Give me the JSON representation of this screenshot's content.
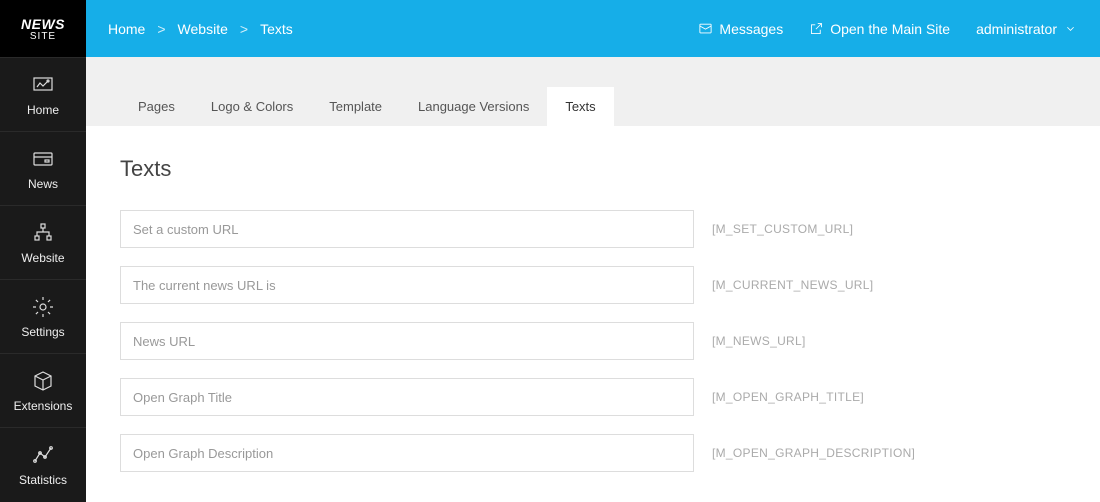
{
  "logo": {
    "line1": "NEWS",
    "line2": "SITE"
  },
  "sidebar": {
    "items": [
      {
        "label": "Home"
      },
      {
        "label": "News"
      },
      {
        "label": "Website"
      },
      {
        "label": "Settings"
      },
      {
        "label": "Extensions"
      },
      {
        "label": "Statistics"
      }
    ]
  },
  "breadcrumb": {
    "items": [
      "Home",
      "Website",
      "Texts"
    ]
  },
  "top_actions": {
    "messages": "Messages",
    "open_main": "Open the Main Site",
    "user": "administrator"
  },
  "tabs": {
    "items": [
      "Pages",
      "Logo & Colors",
      "Template",
      "Language Versions",
      "Texts"
    ],
    "active_index": 4
  },
  "panel": {
    "title": "Texts",
    "rows": [
      {
        "value": "Set a custom URL",
        "hint": "[M_SET_CUSTOM_URL]"
      },
      {
        "value": "The current news URL is",
        "hint": "[M_CURRENT_NEWS_URL]"
      },
      {
        "value": "News URL",
        "hint": "[M_NEWS_URL]"
      },
      {
        "value": "Open Graph Title",
        "hint": "[M_OPEN_GRAPH_TITLE]"
      },
      {
        "value": "Open Graph Description",
        "hint": "[M_OPEN_GRAPH_DESCRIPTION]"
      }
    ]
  }
}
